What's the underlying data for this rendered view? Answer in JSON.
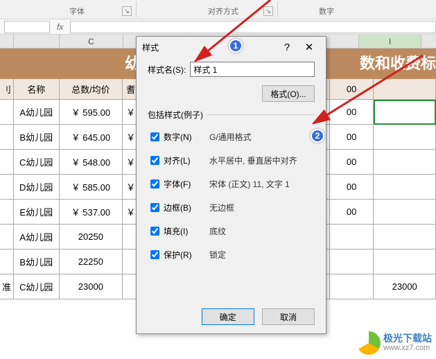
{
  "ribbon": {
    "group_font": "字体",
    "group_align": "对齐方式",
    "group_number": "数字"
  },
  "formula": {
    "fx": "fx"
  },
  "columns": {
    "C": "C",
    "I": "I"
  },
  "title": {
    "left": "幼",
    "right": "数和收费标"
  },
  "table": {
    "headers": {
      "c0": "刂",
      "c1": "名称",
      "c2": "总数/均价",
      "c3": "耆",
      "c7": "00"
    },
    "rows": [
      {
        "name": "A幼儿园",
        "price": "￥ 595.00",
        "y": "￥",
        "c7": "00"
      },
      {
        "name": "B幼儿园",
        "price": "￥ 645.00",
        "y": "￥",
        "c7": "00"
      },
      {
        "name": "C幼儿园",
        "price": "￥ 548.00",
        "y": "￥",
        "c7": "00"
      },
      {
        "name": "D幼儿园",
        "price": "￥ 585.00",
        "y": "￥",
        "c7": "00"
      },
      {
        "name": "E幼儿园",
        "price": "￥ 537.00",
        "y": "￥",
        "c7": "00"
      },
      {
        "name": "A幼儿园",
        "price": "20250",
        "y": "",
        "c7": ""
      },
      {
        "name": "B幼儿园",
        "price": "22250",
        "y": "",
        "c7": ""
      }
    ],
    "last": {
      "c0": "准",
      "name": "C幼儿园",
      "v": "23000"
    }
  },
  "dialog": {
    "title": "样式",
    "name_label": "样式名(S):",
    "name_value": "样式 1",
    "format_btn": "格式(O)...",
    "include_label": "包括样式(例子)",
    "items": [
      {
        "label": "数字(N)",
        "desc": "G/通用格式"
      },
      {
        "label": "对齐(L)",
        "desc": "水平居中, 垂直居中对齐"
      },
      {
        "label": "字体(F)",
        "desc": "宋体 (正文) 11, 文字 1"
      },
      {
        "label": "边框(B)",
        "desc": "无边框"
      },
      {
        "label": "填充(I)",
        "desc": "底纹"
      },
      {
        "label": "保护(R)",
        "desc": "锁定"
      }
    ],
    "ok": "确定",
    "cancel": "取消"
  },
  "badges": {
    "one": "1",
    "two": "2"
  },
  "watermark": {
    "cn": "极光下载站",
    "url": "www.xz7.com"
  }
}
